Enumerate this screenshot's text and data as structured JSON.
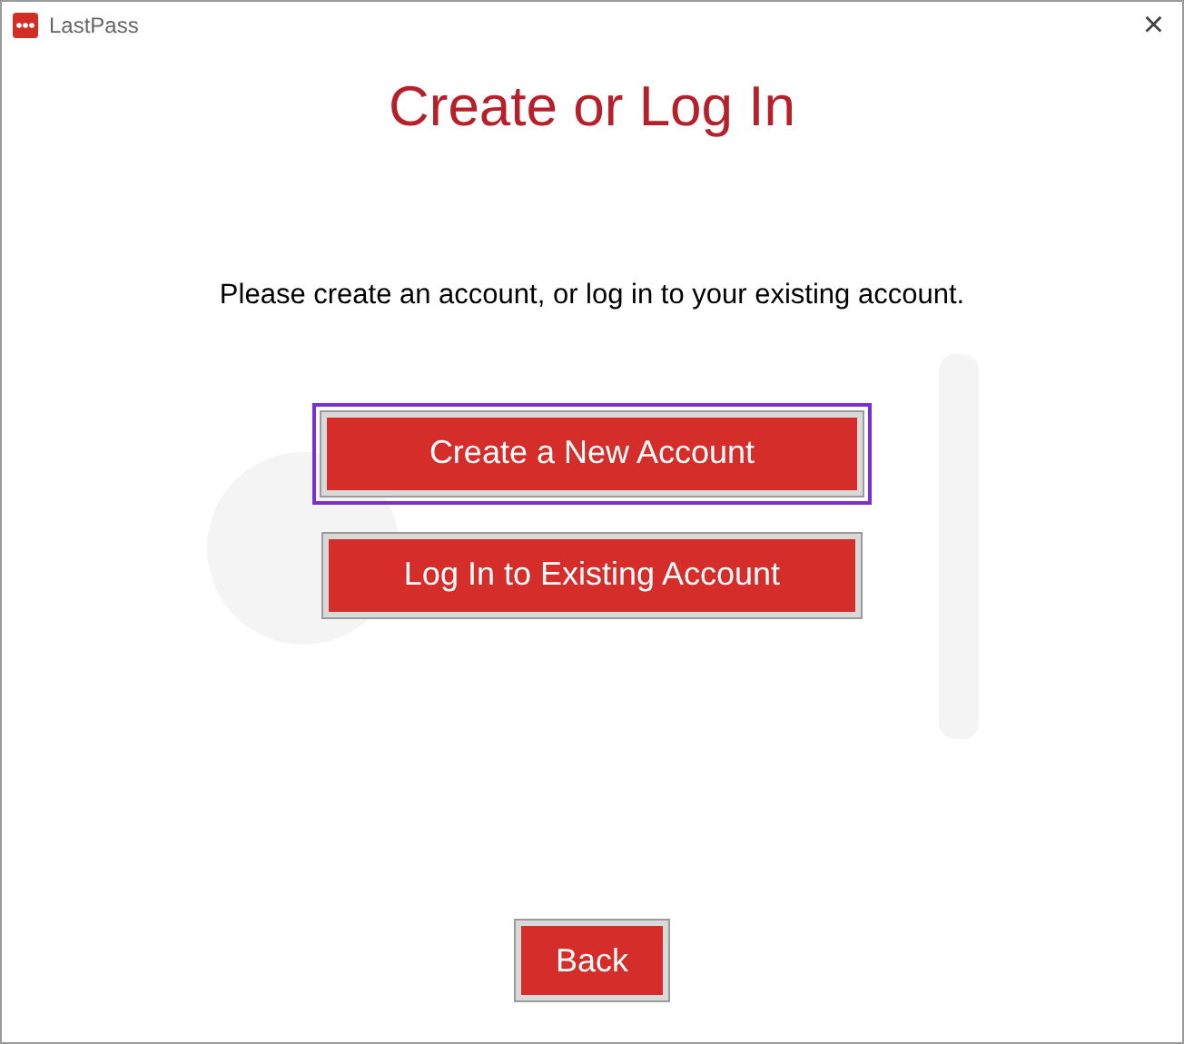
{
  "window": {
    "title": "LastPass",
    "close": "×"
  },
  "heading": "Create or Log In",
  "message": "Please create an account, or log in to your existing account.",
  "buttons": [
    {
      "label": "Create a New Account",
      "focused": true
    },
    {
      "label": "Log In to Existing Account",
      "focused": false
    }
  ],
  "back_button": {
    "label": "Back",
    "focused": false
  }
}
